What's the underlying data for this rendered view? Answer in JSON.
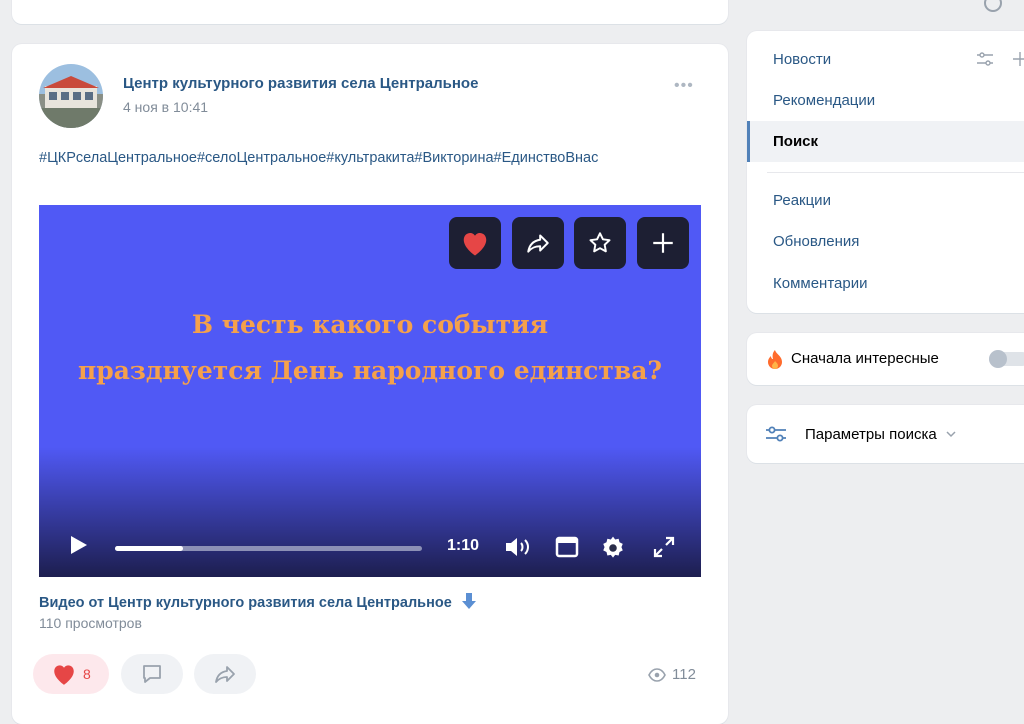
{
  "post": {
    "author": "Центр культурного развития села Центральное",
    "date": "4 ноя в 10:41",
    "more_label": "•••",
    "hashtags": "#ЦКРселаЦентральное#селоЦентральное#культракита#Викторина#ЕдинствоВнас",
    "video": {
      "text_line1": "В честь какого события",
      "text_line2": "празднуется День народного единства?",
      "duration": "1:10",
      "progress": 0.22,
      "bg_color": "#5059f5",
      "text_color": "#f5a14b"
    },
    "video_title": "Видео от Центр культурного развития села Центральное",
    "video_views": "110 просмотров",
    "likes_count": "8",
    "views_count": "112"
  },
  "nav": {
    "items": [
      {
        "label": "Новости"
      },
      {
        "label": "Рекомендации"
      },
      {
        "label": "Поиск"
      },
      {
        "label": "Реакции"
      },
      {
        "label": "Обновления"
      },
      {
        "label": "Комментарии"
      }
    ],
    "active": "Поиск"
  },
  "filter": {
    "interesting_label": "Сначала интересные",
    "interesting_on": false
  },
  "search_params": {
    "label": "Параметры поиска"
  },
  "colors": {
    "link": "#2a5885",
    "accent": "#5181b8",
    "like": "#e64646"
  }
}
